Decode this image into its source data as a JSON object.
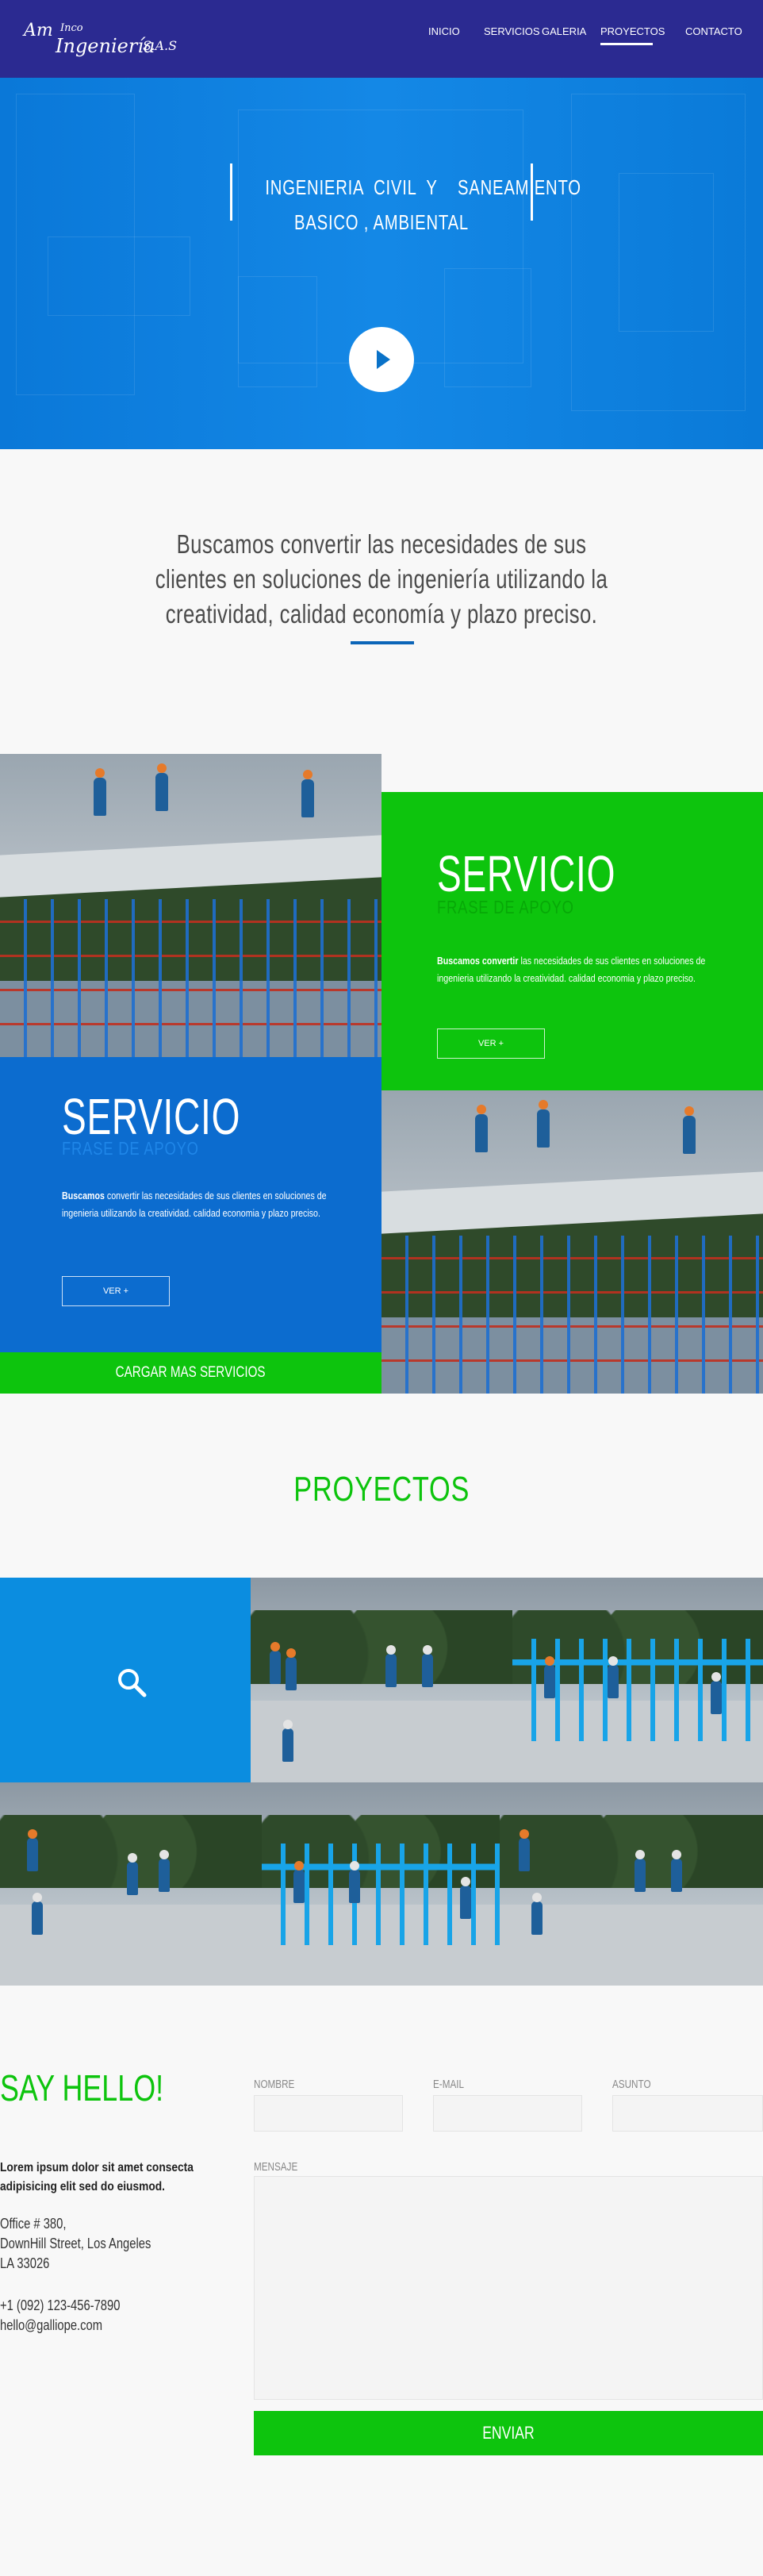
{
  "header": {
    "logo": {
      "line1": "Am",
      "line2": "Ingeniería",
      "line3": "S.A.S",
      "small": "Inco"
    },
    "nav": [
      {
        "label": "INICIO"
      },
      {
        "label": "SERVICIOS"
      },
      {
        "label": "GALERIA"
      },
      {
        "label": "PROYECTOS",
        "active": true
      },
      {
        "label": "CONTACTO"
      }
    ]
  },
  "hero": {
    "title_line1": "INGENIERIA  CIVIL  Y    SANEAMIENTO",
    "title_line2": "BASICO , AMBIENTAL",
    "play_icon": "play-icon"
  },
  "intro": {
    "text": "Buscamos convertir las necesidades de sus clientes en soluciones de ingeniería utilizando la creatividad, calidad economía y plazo preciso."
  },
  "services": [
    {
      "title": "SERVICIO",
      "subtitle": "FRASE DE APOYO",
      "text_bold": "Buscamos convertir",
      "text": " las necesidades de sus clientes en soluciones de ingenieria utilizando la creatividad. calidad economia y plazo preciso.",
      "button": "VER +"
    },
    {
      "title": "SERVICIO",
      "subtitle": "FRASE DE APOYO",
      "text_bold": "Buscamos",
      "text": " convertir las necesidades de sus clientes en soluciones de ingenieria utilizando la creatividad. calidad economia y plazo preciso.",
      "button": "VER +"
    }
  ],
  "load_more": "CARGAR MAS SERVICIOS",
  "projects": {
    "title": "PROYECTOS",
    "search_icon": "search-icon"
  },
  "contact": {
    "title": "SAY HELLO!",
    "tagline": "Lorem ipsum dolor sit amet consecta adipisicing elit sed do eiusmod.",
    "address1": "Office # 380,",
    "address2": "DownHill Street, Los Angeles",
    "address3": "LA 33026",
    "phone": "+1 (092) 123-456-7890",
    "email": "hello@galliope.com",
    "form": {
      "name_label": "NOMBRE",
      "email_label": "E-MAIL",
      "subject_label": "ASUNTO",
      "message_label": "MENSAJE",
      "submit": "ENVIAR"
    }
  },
  "colors": {
    "header": "#2b2a91",
    "hero": "#1488e6",
    "green": "#0dc40d",
    "blue": "#0c6ccf",
    "accent_line": "#0c65b8"
  }
}
